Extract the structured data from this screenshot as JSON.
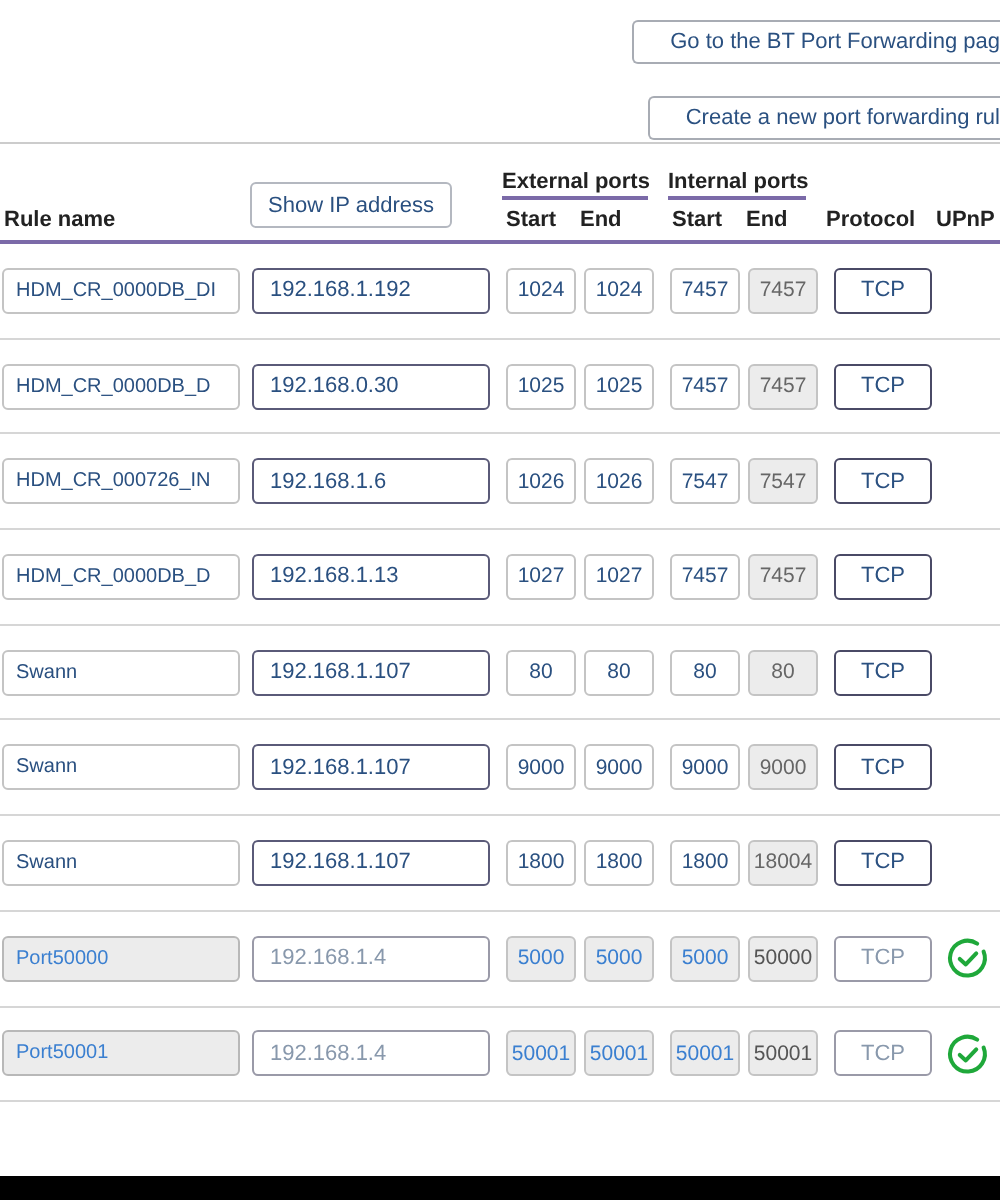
{
  "actions": [
    {
      "label": "Go to the BT Port Forwarding pag"
    },
    {
      "label": "Create a new port forwarding rul"
    }
  ],
  "table": {
    "columns": {
      "rule_name": "Rule name",
      "show_ip_button": "Show IP address",
      "external_group": "External ports",
      "internal_group": "Internal ports",
      "external_start": "Start",
      "external_end": "End",
      "internal_start": "Start",
      "internal_end": "End",
      "protocol": "Protocol",
      "upnp": "UPnP"
    },
    "rows": [
      {
        "name": "HDM_CR_0000DB_DI",
        "ip": "192.168.1.192",
        "ext_start": "1024",
        "ext_end": "1024",
        "int_start": "7457",
        "int_end": "7457",
        "protocol": "TCP",
        "upnp": false
      },
      {
        "name": "HDM_CR_0000DB_D",
        "ip": "192.168.0.30",
        "ext_start": "1025",
        "ext_end": "1025",
        "int_start": "7457",
        "int_end": "7457",
        "protocol": "TCP",
        "upnp": false
      },
      {
        "name": "HDM_CR_000726_IN",
        "ip": "192.168.1.6",
        "ext_start": "1026",
        "ext_end": "1026",
        "int_start": "7547",
        "int_end": "7547",
        "protocol": "TCP",
        "upnp": false
      },
      {
        "name": "HDM_CR_0000DB_D",
        "ip": "192.168.1.13",
        "ext_start": "1027",
        "ext_end": "1027",
        "int_start": "7457",
        "int_end": "7457",
        "protocol": "TCP",
        "upnp": false
      },
      {
        "name": "Swann",
        "ip": "192.168.1.107",
        "ext_start": "80",
        "ext_end": "80",
        "int_start": "80",
        "int_end": "80",
        "protocol": "TCP",
        "upnp": false
      },
      {
        "name": "Swann",
        "ip": "192.168.1.107",
        "ext_start": "9000",
        "ext_end": "9000",
        "int_start": "9000",
        "int_end": "9000",
        "protocol": "TCP",
        "upnp": false
      },
      {
        "name": "Swann",
        "ip": "192.168.1.107",
        "ext_start": "1800",
        "ext_end": "1800",
        "int_start": "1800",
        "int_end": "18004",
        "protocol": "TCP",
        "upnp": false
      },
      {
        "name": "Port50000",
        "ip": "192.168.1.4",
        "ext_start": "5000",
        "ext_end": "5000",
        "int_start": "5000",
        "int_end": "50000",
        "protocol": "TCP",
        "upnp": true
      },
      {
        "name": "Port50001",
        "ip": "192.168.1.4",
        "ext_start": "50001",
        "ext_end": "50001",
        "int_start": "50001",
        "int_end": "50001",
        "protocol": "TCP",
        "upnp": true
      }
    ]
  }
}
